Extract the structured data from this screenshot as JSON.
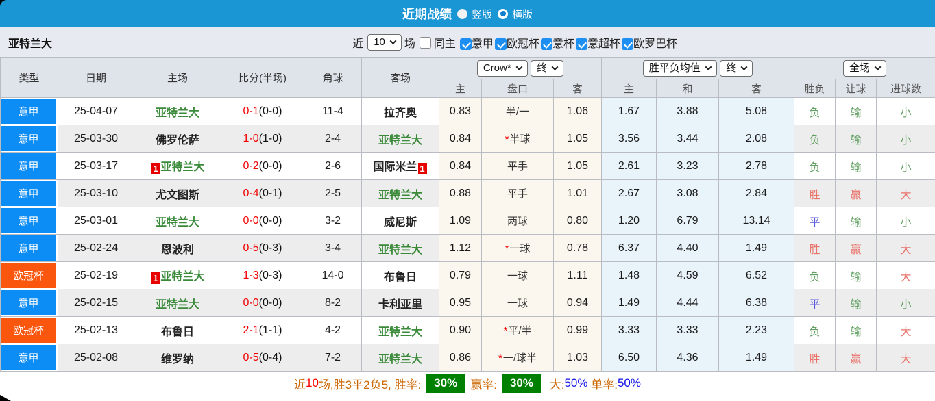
{
  "header": {
    "title": "近期战绩",
    "view_options": [
      {
        "label": "竖版",
        "selected": false
      },
      {
        "label": "横版",
        "selected": true
      }
    ]
  },
  "filter_bar": {
    "team": "亚特兰大",
    "recent_label": "近",
    "recent_value": "10",
    "matches_label": "场",
    "same_home": {
      "label": "同主",
      "checked": false
    },
    "leagues": [
      {
        "label": "意甲",
        "checked": true
      },
      {
        "label": "欧冠杯",
        "checked": true
      },
      {
        "label": "意杯",
        "checked": true
      },
      {
        "label": "意超杯",
        "checked": true
      },
      {
        "label": "欧罗巴杯",
        "checked": true
      }
    ]
  },
  "table": {
    "left_headers": [
      "类型",
      "日期",
      "主场",
      "比分(半场)",
      "角球",
      "客场"
    ],
    "groups": [
      {
        "selects": [
          "Crow*",
          "终"
        ],
        "subheaders": [
          "主",
          "盘口",
          "客"
        ]
      },
      {
        "selects": [
          "胜平负均值",
          "终"
        ],
        "subheaders": [
          "主",
          "和",
          "客"
        ]
      },
      {
        "selects": [
          "全场"
        ],
        "subheaders": [
          "胜负",
          "让球",
          "进球数"
        ]
      }
    ],
    "rows": [
      {
        "league": {
          "label": "意甲",
          "color": "blue"
        },
        "date": "25-04-07",
        "home": {
          "name": "亚特兰大",
          "green": true,
          "red_card": null
        },
        "score": {
          "full": "0-1",
          "half": "(0-0)"
        },
        "corners": "11-4",
        "away": {
          "name": "拉齐奥",
          "green": false,
          "red_card": null
        },
        "handicap": {
          "home": "0.83",
          "line": "半/一",
          "away": "1.06",
          "star": false
        },
        "europe": {
          "home": "1.67",
          "draw": "3.88",
          "away": "5.08"
        },
        "results": [
          {
            "label": "负",
            "color": "green"
          },
          {
            "label": "输",
            "color": "green"
          },
          {
            "label": "小",
            "color": "green"
          }
        ]
      },
      {
        "league": {
          "label": "意甲",
          "color": "blue"
        },
        "date": "25-03-30",
        "home": {
          "name": "佛罗伦萨",
          "green": false,
          "red_card": null
        },
        "score": {
          "full": "1-0",
          "half": "(1-0)"
        },
        "corners": "2-4",
        "away": {
          "name": "亚特兰大",
          "green": true,
          "red_card": null
        },
        "handicap": {
          "home": "0.84",
          "line": "半球",
          "away": "1.05",
          "star": true
        },
        "europe": {
          "home": "3.56",
          "draw": "3.44",
          "away": "2.08"
        },
        "results": [
          {
            "label": "负",
            "color": "green"
          },
          {
            "label": "输",
            "color": "green"
          },
          {
            "label": "小",
            "color": "green"
          }
        ]
      },
      {
        "league": {
          "label": "意甲",
          "color": "blue"
        },
        "date": "25-03-17",
        "home": {
          "name": "亚特兰大",
          "green": true,
          "red_card": "before"
        },
        "score": {
          "full": "0-2",
          "half": "(0-0)"
        },
        "corners": "2-6",
        "away": {
          "name": "国际米兰",
          "green": false,
          "red_card": "after"
        },
        "handicap": {
          "home": "0.84",
          "line": "平手",
          "away": "1.05",
          "star": false
        },
        "europe": {
          "home": "2.61",
          "draw": "3.23",
          "away": "2.78"
        },
        "results": [
          {
            "label": "负",
            "color": "green"
          },
          {
            "label": "输",
            "color": "green"
          },
          {
            "label": "小",
            "color": "green"
          }
        ]
      },
      {
        "league": {
          "label": "意甲",
          "color": "blue"
        },
        "date": "25-03-10",
        "home": {
          "name": "尤文图斯",
          "green": false,
          "red_card": null
        },
        "score": {
          "full": "0-4",
          "half": "(0-1)"
        },
        "corners": "2-5",
        "away": {
          "name": "亚特兰大",
          "green": true,
          "red_card": null
        },
        "handicap": {
          "home": "0.88",
          "line": "平手",
          "away": "1.01",
          "star": false
        },
        "europe": {
          "home": "2.67",
          "draw": "3.08",
          "away": "2.84"
        },
        "results": [
          {
            "label": "胜",
            "color": "red"
          },
          {
            "label": "赢",
            "color": "red"
          },
          {
            "label": "大",
            "color": "red"
          }
        ]
      },
      {
        "league": {
          "label": "意甲",
          "color": "blue"
        },
        "date": "25-03-01",
        "home": {
          "name": "亚特兰大",
          "green": true,
          "red_card": null
        },
        "score": {
          "full": "0-0",
          "half": "(0-0)"
        },
        "corners": "3-2",
        "away": {
          "name": "威尼斯",
          "green": false,
          "red_card": null
        },
        "handicap": {
          "home": "1.09",
          "line": "两球",
          "away": "0.80",
          "star": false
        },
        "europe": {
          "home": "1.20",
          "draw": "6.79",
          "away": "13.14"
        },
        "results": [
          {
            "label": "平",
            "color": "blue"
          },
          {
            "label": "输",
            "color": "green"
          },
          {
            "label": "小",
            "color": "green"
          }
        ]
      },
      {
        "league": {
          "label": "意甲",
          "color": "blue"
        },
        "date": "25-02-24",
        "home": {
          "name": "恩波利",
          "green": false,
          "red_card": null
        },
        "score": {
          "full": "0-5",
          "half": "(0-3)"
        },
        "corners": "3-4",
        "away": {
          "name": "亚特兰大",
          "green": true,
          "red_card": null
        },
        "handicap": {
          "home": "1.12",
          "line": "一球",
          "away": "0.78",
          "star": true
        },
        "europe": {
          "home": "6.37",
          "draw": "4.40",
          "away": "1.49"
        },
        "results": [
          {
            "label": "胜",
            "color": "red"
          },
          {
            "label": "赢",
            "color": "red"
          },
          {
            "label": "大",
            "color": "red"
          }
        ]
      },
      {
        "league": {
          "label": "欧冠杯",
          "color": "orange"
        },
        "date": "25-02-19",
        "home": {
          "name": "亚特兰大",
          "green": true,
          "red_card": "before"
        },
        "score": {
          "full": "1-3",
          "half": "(0-3)"
        },
        "corners": "14-0",
        "away": {
          "name": "布鲁日",
          "green": false,
          "red_card": null
        },
        "handicap": {
          "home": "0.79",
          "line": "一球",
          "away": "1.11",
          "star": false
        },
        "europe": {
          "home": "1.48",
          "draw": "4.59",
          "away": "6.52"
        },
        "results": [
          {
            "label": "负",
            "color": "green"
          },
          {
            "label": "输",
            "color": "green"
          },
          {
            "label": "大",
            "color": "red"
          }
        ]
      },
      {
        "league": {
          "label": "意甲",
          "color": "blue"
        },
        "date": "25-02-15",
        "home": {
          "name": "亚特兰大",
          "green": true,
          "red_card": null
        },
        "score": {
          "full": "0-0",
          "half": "(0-0)"
        },
        "corners": "8-2",
        "away": {
          "name": "卡利亚里",
          "green": false,
          "red_card": null
        },
        "handicap": {
          "home": "0.95",
          "line": "一球",
          "away": "0.94",
          "star": false
        },
        "europe": {
          "home": "1.49",
          "draw": "4.44",
          "away": "6.38"
        },
        "results": [
          {
            "label": "平",
            "color": "blue"
          },
          {
            "label": "输",
            "color": "green"
          },
          {
            "label": "小",
            "color": "green"
          }
        ]
      },
      {
        "league": {
          "label": "欧冠杯",
          "color": "orange"
        },
        "date": "25-02-13",
        "home": {
          "name": "布鲁日",
          "green": false,
          "red_card": null
        },
        "score": {
          "full": "2-1",
          "half": "(1-1)"
        },
        "corners": "4-2",
        "away": {
          "name": "亚特兰大",
          "green": true,
          "red_card": null
        },
        "handicap": {
          "home": "0.90",
          "line": "平/半",
          "away": "0.99",
          "star": true
        },
        "europe": {
          "home": "3.33",
          "draw": "3.33",
          "away": "2.23"
        },
        "results": [
          {
            "label": "负",
            "color": "green"
          },
          {
            "label": "输",
            "color": "green"
          },
          {
            "label": "大",
            "color": "red"
          }
        ]
      },
      {
        "league": {
          "label": "意甲",
          "color": "blue"
        },
        "date": "25-02-08",
        "home": {
          "name": "维罗纳",
          "green": false,
          "red_card": null
        },
        "score": {
          "full": "0-5",
          "half": "(0-4)"
        },
        "corners": "7-2",
        "away": {
          "name": "亚特兰大",
          "green": true,
          "red_card": null
        },
        "handicap": {
          "home": "0.86",
          "line": "一/球半",
          "away": "1.03",
          "star": true
        },
        "europe": {
          "home": "6.50",
          "draw": "4.36",
          "away": "1.49"
        },
        "results": [
          {
            "label": "胜",
            "color": "red"
          },
          {
            "label": "赢",
            "color": "red"
          },
          {
            "label": "大",
            "color": "red"
          }
        ]
      }
    ]
  },
  "summary": {
    "segments": [
      {
        "text": "近",
        "color": "orange"
      },
      {
        "text": "10",
        "color": "red"
      },
      {
        "text": "场,胜3平2负5, 胜率:",
        "color": "orange"
      },
      {
        "text": "30%",
        "badge": true
      },
      {
        "text": "赢率:",
        "color": "orange"
      },
      {
        "text": "30%",
        "badge": true
      },
      {
        "text": " 大:",
        "color": "orange"
      },
      {
        "text": "50%",
        "color": "blue"
      },
      {
        "text": " 单率:",
        "color": "orange"
      },
      {
        "text": "50%",
        "color": "blue"
      }
    ]
  }
}
